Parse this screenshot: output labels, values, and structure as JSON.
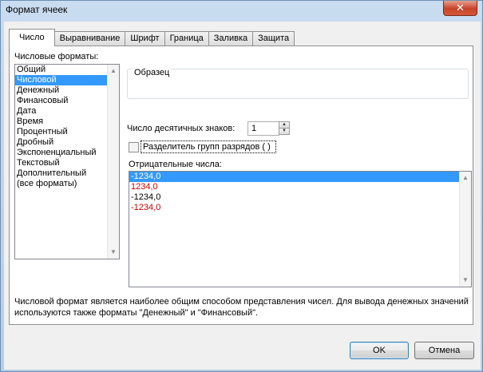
{
  "window": {
    "title": "Формат ячеек",
    "close_symbol": "✕"
  },
  "tabs": [
    {
      "label": "Число",
      "active": true
    },
    {
      "label": "Выравнивание"
    },
    {
      "label": "Шрифт"
    },
    {
      "label": "Граница"
    },
    {
      "label": "Заливка"
    },
    {
      "label": "Защита"
    }
  ],
  "formats": {
    "label": "Числовые форматы:",
    "items": [
      "Общий",
      "Числовой",
      "Денежный",
      "Финансовый",
      "Дата",
      "Время",
      "Процентный",
      "Дробный",
      "Экспоненциальный",
      "Текстовый",
      "Дополнительный",
      "(все форматы)"
    ],
    "selected_index": 1
  },
  "sample": {
    "label": "Образец",
    "value": ""
  },
  "decimals": {
    "label": "Число десятичных знаков:",
    "value": "1"
  },
  "separator": {
    "label": "Разделитель групп разрядов ( )",
    "checked": false
  },
  "negative": {
    "label": "Отрицательные числа:",
    "items": [
      {
        "text": "-1234,0",
        "color": "black",
        "selected": true
      },
      {
        "text": "1234,0",
        "color": "red"
      },
      {
        "text": "-1234,0",
        "color": "black"
      },
      {
        "text": "-1234,0",
        "color": "red"
      }
    ]
  },
  "description": "Числовой формат является наиболее общим способом представления чисел. Для вывода денежных значений используются также форматы \"Денежный\" и \"Финансовый\".",
  "buttons": {
    "ok": "OK",
    "cancel": "Отмена"
  },
  "colors": {
    "selection": "#3399ff",
    "negative_red": "#d00000"
  }
}
